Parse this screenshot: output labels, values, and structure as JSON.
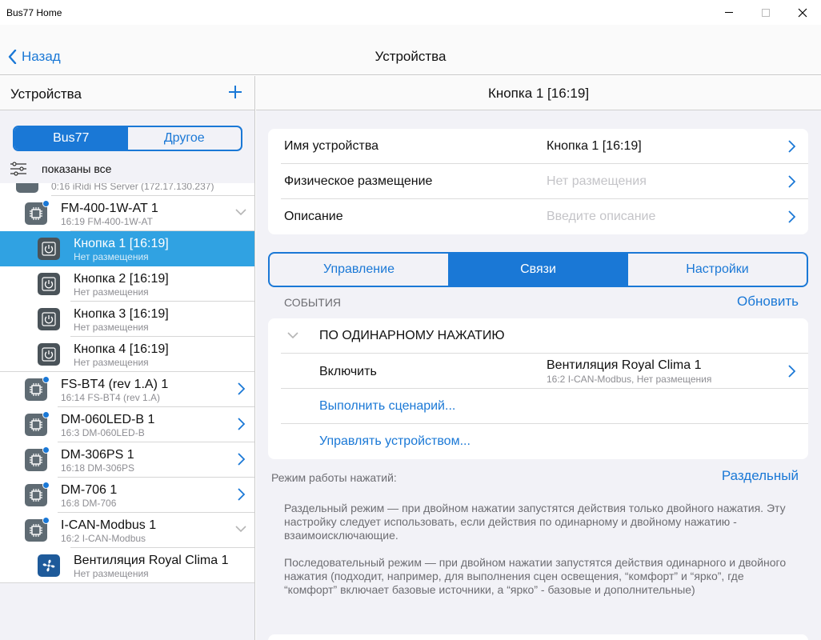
{
  "window": {
    "title": "Bus77 Home"
  },
  "navbar": {
    "back_label": "Назад",
    "title": "Устройства"
  },
  "left": {
    "header": "Устройства",
    "segments": [
      "Bus77",
      "Другое"
    ],
    "filter_label": "показаны все",
    "rows": [
      {
        "title": "",
        "subtitle": "0:16 iRidi HS Server (172.17.130.237)"
      },
      {
        "title": "FM-400-1W-AT 1",
        "subtitle": "16:19 FM-400-1W-AT"
      },
      {
        "title": "Кнопка 1 [16:19]",
        "subtitle": "Нет размещения"
      },
      {
        "title": "Кнопка 2 [16:19]",
        "subtitle": "Нет размещения"
      },
      {
        "title": "Кнопка 3 [16:19]",
        "subtitle": "Нет размещения"
      },
      {
        "title": "Кнопка 4 [16:19]",
        "subtitle": "Нет размещения"
      },
      {
        "title": "FS-BT4 (rev 1.A) 1",
        "subtitle": "16:14 FS-BT4 (rev 1.A)"
      },
      {
        "title": "DM-060LED-B 1",
        "subtitle": "16:3 DM-060LED-B"
      },
      {
        "title": "DM-306PS 1",
        "subtitle": "16:18 DM-306PS"
      },
      {
        "title": "DM-706 1",
        "subtitle": "16:8 DM-706"
      },
      {
        "title": "I-CAN-Modbus 1",
        "subtitle": "16:2 I-CAN-Modbus"
      },
      {
        "title": "Вентиляция Royal Clima 1",
        "subtitle": "Нет размещения"
      }
    ]
  },
  "right": {
    "header": "Кнопка 1 [16:19]",
    "info": [
      {
        "key": "Имя устройства",
        "value": "Кнопка 1 [16:19]",
        "placeholder": false
      },
      {
        "key": "Физическое размещение",
        "value": "Нет размещения",
        "placeholder": true
      },
      {
        "key": "Описание",
        "value": "Введите описание",
        "placeholder": true
      }
    ],
    "tabs": [
      "Управление",
      "Связи",
      "Настройки"
    ],
    "active_tab": "Связи",
    "events_label": "СОБЫТИЯ",
    "refresh_label": "Обновить",
    "event": {
      "title": "ПО ОДИНАРНОМУ НАЖАТИЮ",
      "action": "Включить",
      "target": "Вентиляция Royal Clima 1",
      "target_sub": "16:2 I-CAN-Modbus, Нет размещения",
      "link1": "Выполнить сценарий...",
      "link2": "Управлять устройством..."
    },
    "mode_label": "Режим работы нажатий:",
    "mode_value": "Раздельный",
    "desc1": "Раздельный режим — при двойном нажатии запустятся действия только двойного нажатия. Эту настройку следует использовать, если действия по одинарному и двойному нажатию - взаимоисключающие.",
    "desc2": "Последовательный режим — при двойном нажатии запустятся действия одинарного и двойного нажатия (подходит, например, для выполнения сцен освещения, “комфорт” и “ярко”, где “комфорт” включает базовые источники, а “ярко” - базовые и дополнительные)"
  },
  "colors": {
    "accent": "#1a78d6",
    "selected_row": "#30a2e2"
  }
}
